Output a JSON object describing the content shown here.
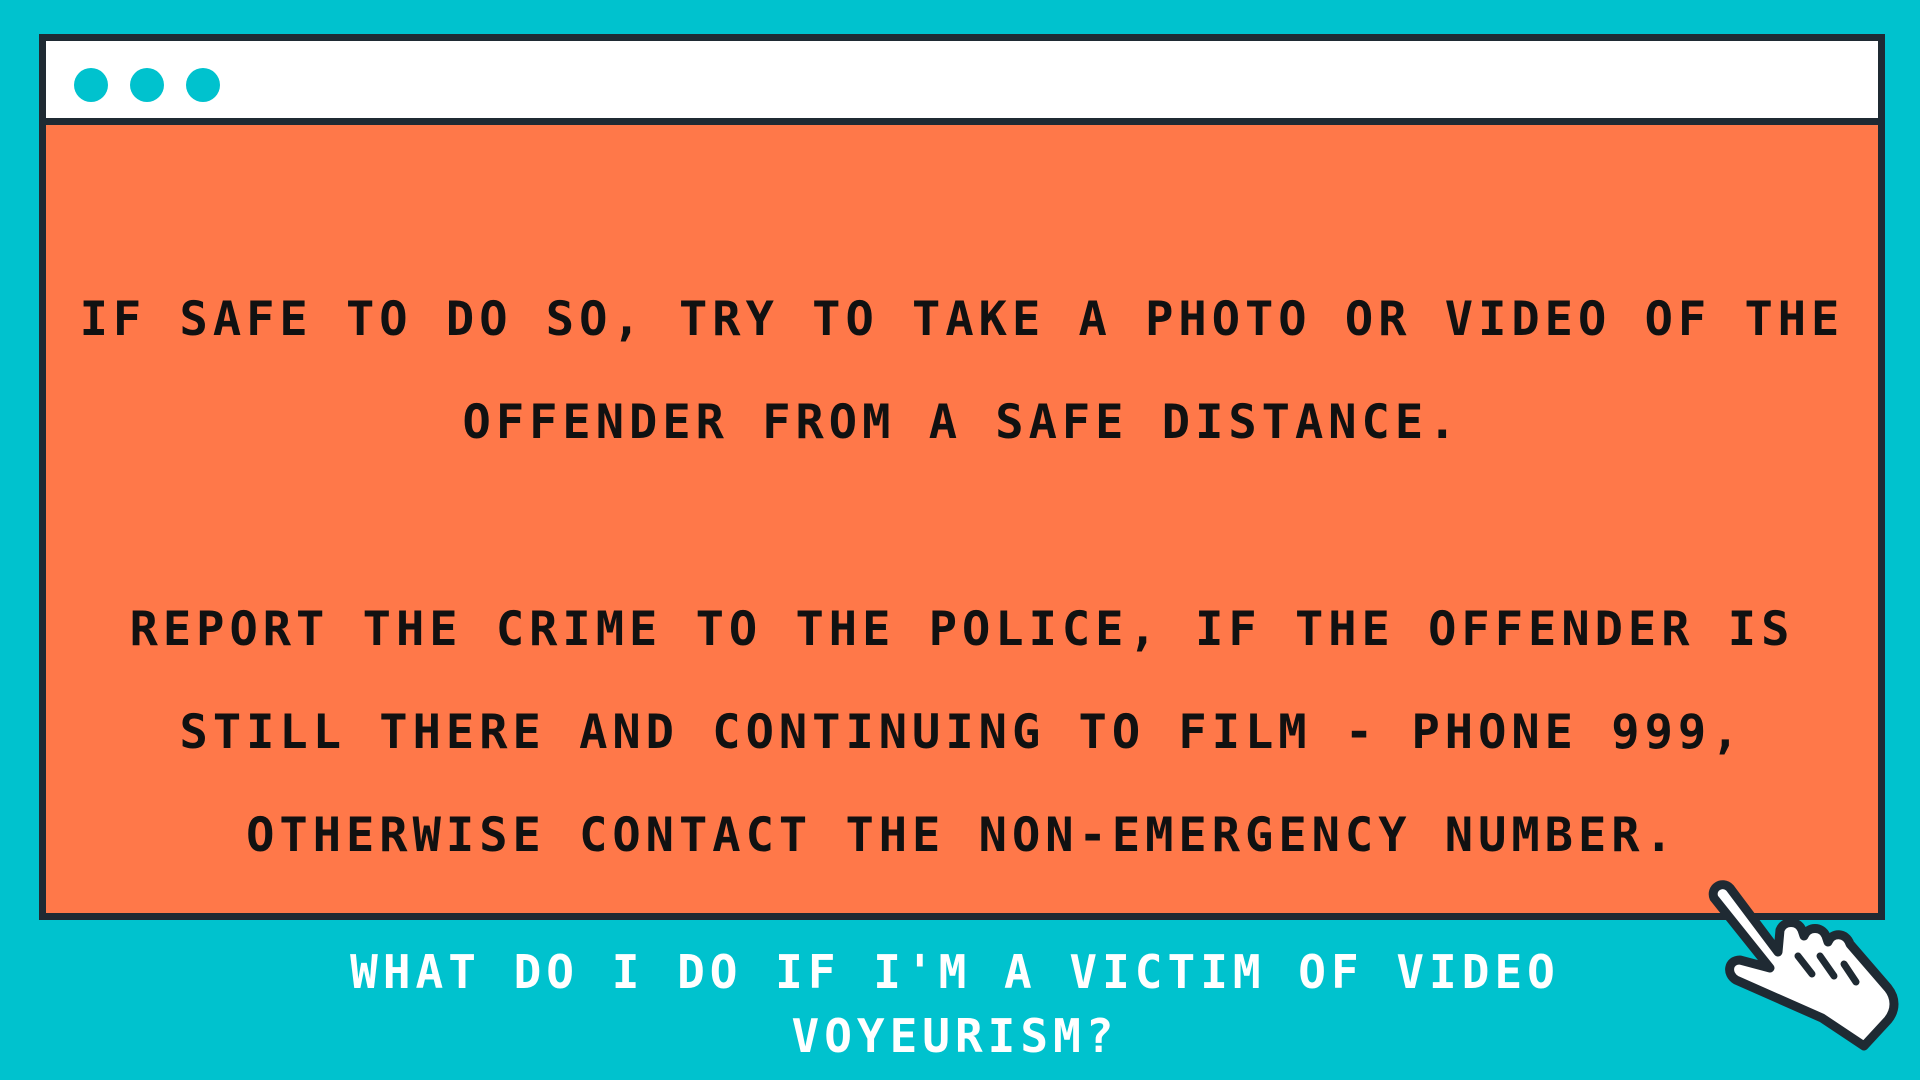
{
  "colors": {
    "background": "#00c2ce",
    "window_body": "#ff7849",
    "window_border": "#1f2a33",
    "titlebar": "#ffffff",
    "dot": "#00c2ce",
    "body_text": "#111111",
    "caption_text": "#ffffff"
  },
  "window": {
    "paragraphs": [
      "IF SAFE TO DO SO, TRY TO TAKE A PHOTO OR VIDEO OF THE OFFENDER FROM A SAFE DISTANCE.",
      "REPORT THE CRIME TO THE POLICE, IF THE OFFENDER IS STILL THERE AND CONTINUING TO FILM - PHONE 999, OTHERWISE CONTACT THE NON-EMERGENCY NUMBER."
    ]
  },
  "caption": "WHAT DO I DO IF I'M A VICTIM OF VIDEO VOYEURISM?",
  "icons": {
    "cursor": "pointing-hand-icon",
    "window_dots": "circle-icon"
  }
}
